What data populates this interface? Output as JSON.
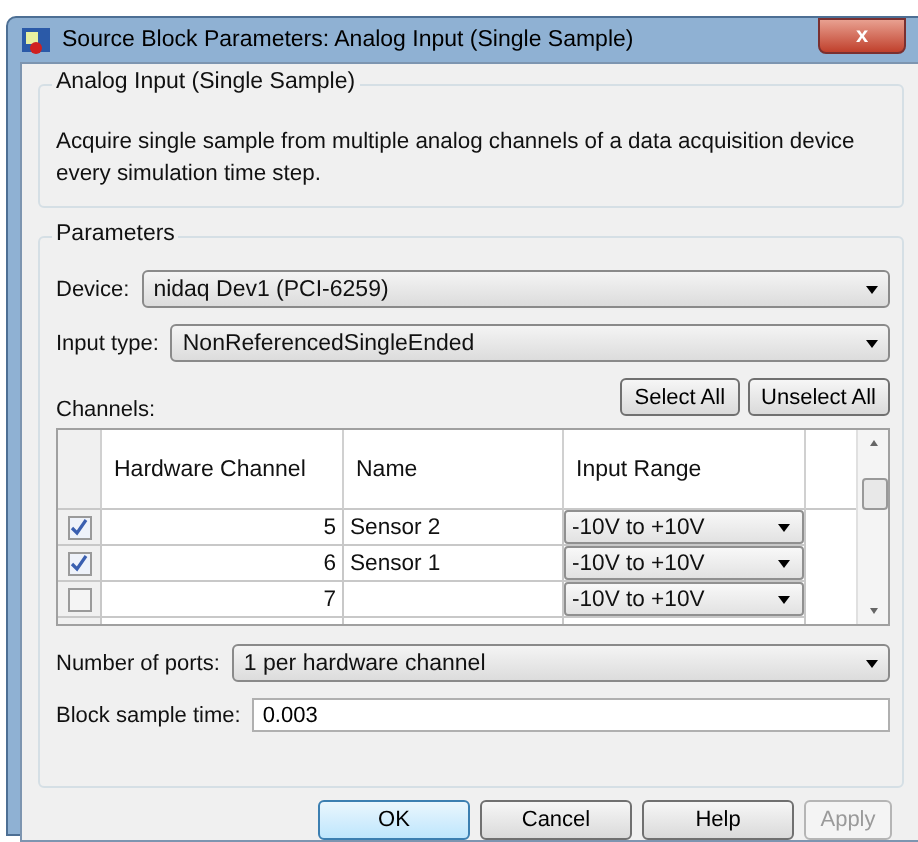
{
  "window": {
    "title": "Source Block Parameters: Analog Input (Single Sample)",
    "close": "x"
  },
  "description_group": {
    "title": "Analog Input (Single Sample)",
    "text": "Acquire single sample from multiple analog channels of a data acquisition device every simulation time step."
  },
  "parameters": {
    "title": "Parameters",
    "device": {
      "label": "Device:",
      "value": "nidaq Dev1 (PCI-6259)"
    },
    "input_type": {
      "label": "Input type:",
      "value": "NonReferencedSingleEnded"
    },
    "channels_label": "Channels:",
    "channel_buttons": [
      "Select All",
      "Unselect All"
    ],
    "table": {
      "columns": [
        "Hardware Channel",
        "Name",
        "Input Range"
      ],
      "rows": [
        {
          "checked": true,
          "hardware_channel": "5",
          "name": "Sensor 2",
          "input_range": "-10V to +10V"
        },
        {
          "checked": true,
          "hardware_channel": "6",
          "name": "Sensor 1",
          "input_range": "-10V to +10V"
        },
        {
          "checked": false,
          "hardware_channel": "7",
          "input_range": "-10V to +10V"
        }
      ]
    },
    "number_of_ports": {
      "label": "Number of ports:",
      "value": "1 per hardware channel"
    },
    "block_sample_time": {
      "label": "Block sample time:",
      "value": "0.003"
    }
  },
  "buttons": [
    {
      "label": "OK",
      "kind": "default",
      "disabled": false
    },
    {
      "label": "Cancel",
      "kind": "normal",
      "disabled": false
    },
    {
      "label": "Help",
      "kind": "normal",
      "disabled": false
    },
    {
      "label": "Apply",
      "kind": "normal",
      "disabled": true
    }
  ]
}
